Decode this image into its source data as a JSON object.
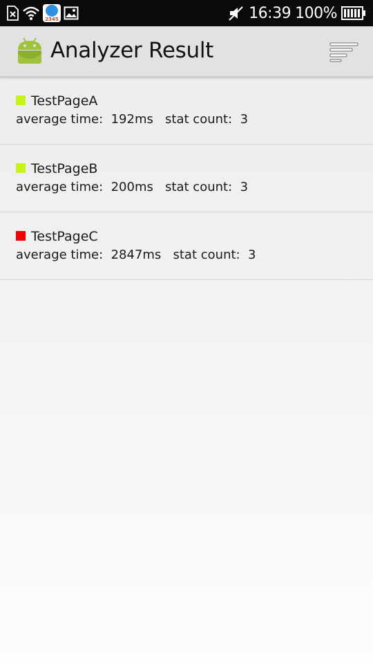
{
  "status_bar": {
    "time": "16:39",
    "battery_percent": "100%",
    "icons": [
      "sim-error-icon",
      "wifi-icon",
      "app-notification-icon",
      "image-icon",
      "mute-icon",
      "battery-icon"
    ],
    "app_badge_text": "2345"
  },
  "app_bar": {
    "title": "Analyzer Result",
    "logo_icon": "android-icon",
    "menu_icon": "sort-menu-icon",
    "logo_color": "#9fc23a"
  },
  "results": [
    {
      "name": "TestPageA",
      "color": "#c8f316",
      "average_time_label": "average time:",
      "average_time": "192ms",
      "stat_count_label": "stat count:",
      "stat_count": "3"
    },
    {
      "name": "TestPageB",
      "color": "#c8f316",
      "average_time_label": "average time:",
      "average_time": "200ms",
      "stat_count_label": "stat count:",
      "stat_count": "3"
    },
    {
      "name": "TestPageC",
      "color": "#f50000",
      "average_time_label": "average time:",
      "average_time": "2847ms",
      "stat_count_label": "stat count:",
      "stat_count": "3"
    }
  ]
}
